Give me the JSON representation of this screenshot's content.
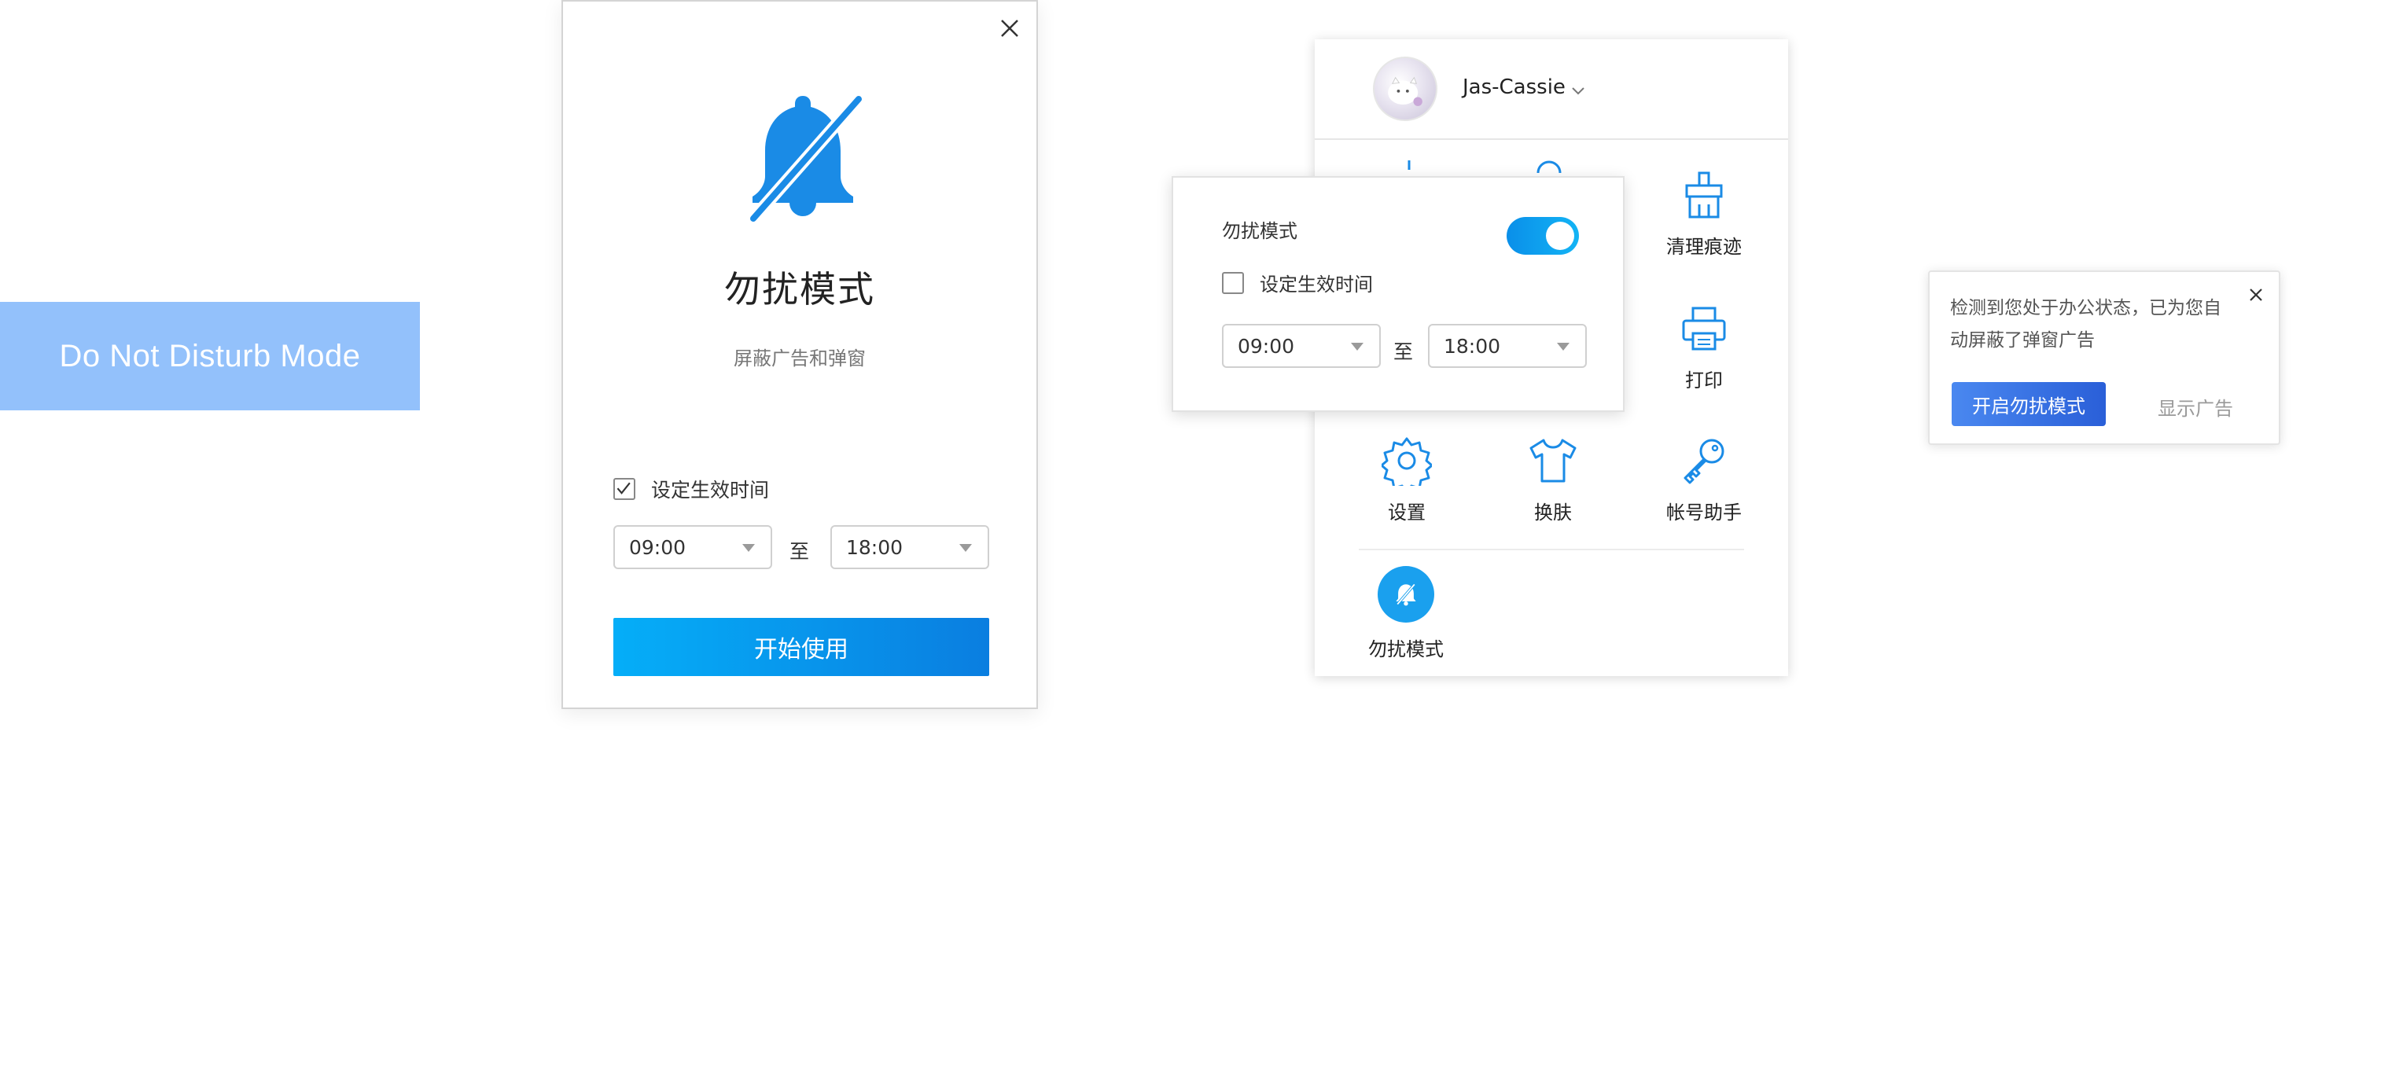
{
  "label": {
    "text": "Do Not Disturb Mode",
    "bg_color": "#93c1fb"
  },
  "dialog": {
    "title": "勿扰模式",
    "subtitle": "屏蔽广告和弹窗",
    "checkbox_label": "设定生效时间",
    "checkbox_checked": true,
    "start_time": "09:00",
    "to_label": "至",
    "end_time": "18:00",
    "start_button": "开始使用",
    "accent_color": "#1a8be6"
  },
  "panel": {
    "username": "Jas-Cassie",
    "items": [
      {
        "label": "清理痕迹",
        "icon": "broom-icon"
      },
      {
        "label": "打印",
        "icon": "printer-icon"
      },
      {
        "label": "设置",
        "icon": "gear-icon"
      },
      {
        "label": "换肤",
        "icon": "shirt-icon"
      },
      {
        "label": "帐号助手",
        "icon": "key-icon"
      }
    ],
    "dnd_label": "勿扰模式"
  },
  "popover": {
    "title": "勿扰模式",
    "toggle_on": true,
    "checkbox_label": "设定生效时间",
    "checkbox_checked": false,
    "start_time": "09:00",
    "to_label": "至",
    "end_time": "18:00"
  },
  "notification": {
    "text": "检测到您处于办公状态，已为您自动屏蔽了弹窗广告",
    "enable_button": "开启勿扰模式",
    "show_ads": "显示广告"
  }
}
